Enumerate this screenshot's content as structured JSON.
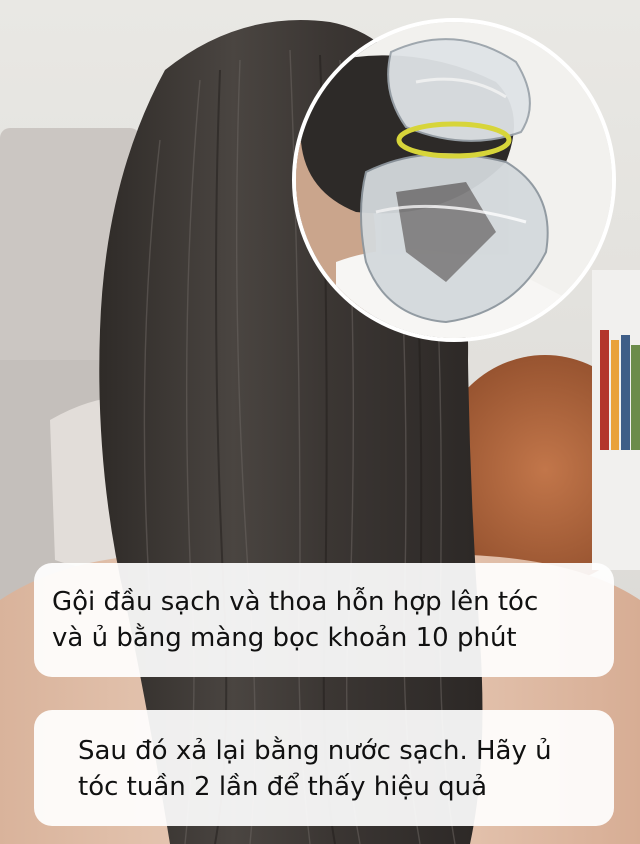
{
  "captions": [
    {
      "lines": [
        "Gội đầu sạch và thoa hỗn hợp lên tóc",
        "và ủ bằng màng bọc khoản 10 phút"
      ]
    },
    {
      "lines": [
        "Sau đó xả lại bằng nước sạch. Hãy ủ",
        "tóc tuần 2 lần để thấy hiệu quả"
      ]
    }
  ],
  "colors": {
    "wall": "#e4e3df",
    "sofa": "#c9c4c0",
    "hair": "#3a3633",
    "skin": "#e7c9b4",
    "pillow_orange": "#b5673a",
    "caption_bg": "#ffffff"
  }
}
